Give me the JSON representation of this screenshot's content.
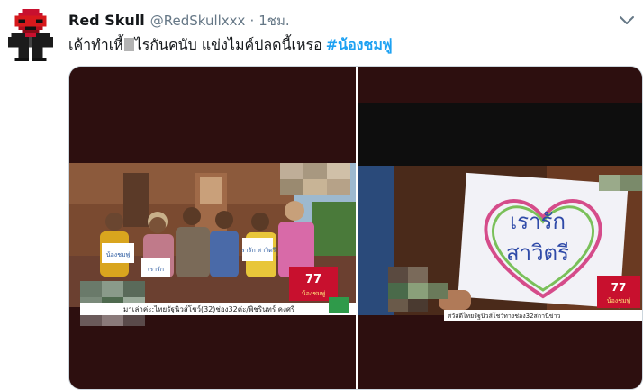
{
  "tweet": {
    "display_name": "Red Skull",
    "handle": "@RedSkullxxx",
    "separator": "·",
    "time": "1ชม.",
    "text_part1": "เค้าทำเหี้",
    "text_part2": "ไรกันคนับ แข่งไมค์ปลดนี้เหรอ",
    "hashtag": "#น้องชมพู่",
    "icons": {
      "avatar": "red-skull-pixel-avatar",
      "menu": "chevron-down-icon"
    },
    "colors": {
      "link": "#1da1f2",
      "secondary": "#657786",
      "photo_bg": "#2d0f0f"
    }
  },
  "photo_left": {
    "sign_1": "น้องชมพู่",
    "sign_2": "เรารัก",
    "sign_3": "เรารัก\nสาวิตรี",
    "badge": "77",
    "badge_sub": "น้องชมพู่",
    "caption": "มาเล่าค่ะ:ไทยรัฐนิวส์โชว์(32)ช่อง32ค่ะ/พิชรินทร์ คงศรี"
  },
  "photo_right": {
    "sign_line1": "เรารัก",
    "sign_line2": "สาวิตรี",
    "badge": "77",
    "badge_sub": "น้องชมพู่",
    "caption": "สวัสดีไทยรัฐนิวส์โชว์ทางช่อง32สถานีข่าว"
  }
}
